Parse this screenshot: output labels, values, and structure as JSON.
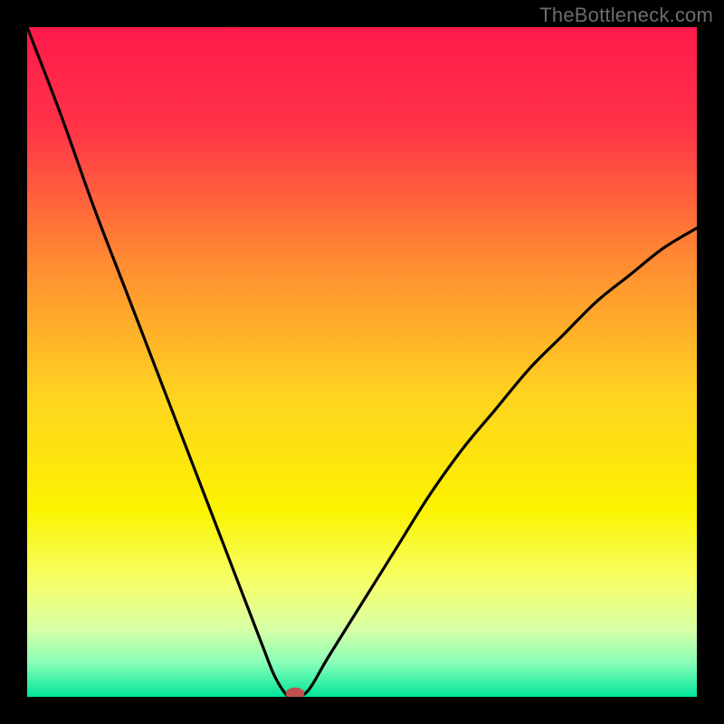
{
  "watermark": "TheBottleneck.com",
  "chart_data": {
    "type": "line",
    "title": "",
    "xlabel": "",
    "ylabel": "",
    "xlim": [
      0,
      100
    ],
    "ylim": [
      0,
      100
    ],
    "grid": false,
    "legend": false,
    "gradient_stops": [
      {
        "offset": 0.0,
        "color": "#ff1a4b"
      },
      {
        "offset": 0.15,
        "color": "#ff3348"
      },
      {
        "offset": 0.35,
        "color": "#ff8b32"
      },
      {
        "offset": 0.55,
        "color": "#ffd320"
      },
      {
        "offset": 0.72,
        "color": "#fbf300"
      },
      {
        "offset": 0.83,
        "color": "#f6ff6b"
      },
      {
        "offset": 0.9,
        "color": "#d6ffa6"
      },
      {
        "offset": 0.95,
        "color": "#88ffb8"
      },
      {
        "offset": 1.0,
        "color": "#00e59a"
      }
    ],
    "series": [
      {
        "name": "bottleneck-curve",
        "color": "#000000",
        "x": [
          0,
          5,
          10,
          15,
          20,
          25,
          30,
          35,
          37,
          39,
          40,
          42,
          45,
          50,
          55,
          60,
          65,
          70,
          75,
          80,
          85,
          90,
          95,
          100
        ],
        "values": [
          100,
          87,
          73,
          60,
          47,
          34,
          21,
          8,
          3,
          0,
          0,
          1,
          6,
          14,
          22,
          30,
          37,
          43,
          49,
          54,
          59,
          63,
          67,
          70
        ]
      }
    ],
    "marker": {
      "x": 40,
      "y": 0.5,
      "color": "#c0504d",
      "rx": 1.4,
      "ry": 0.9
    }
  }
}
